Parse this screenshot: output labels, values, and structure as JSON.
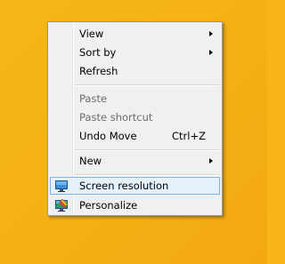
{
  "context_menu": {
    "items": [
      {
        "label": "View",
        "submenu": true
      },
      {
        "label": "Sort by",
        "submenu": true
      },
      {
        "label": "Refresh"
      },
      {
        "label": "Paste",
        "disabled": true
      },
      {
        "label": "Paste shortcut",
        "disabled": true
      },
      {
        "label": "Undo Move",
        "shortcut": "Ctrl+Z"
      },
      {
        "label": "New",
        "submenu": true
      },
      {
        "label": "Screen resolution",
        "icon": "screen-resolution-icon",
        "highlighted": true
      },
      {
        "label": "Personalize",
        "icon": "personalize-icon"
      }
    ]
  },
  "colors": {
    "desktop_background": "#f5b015",
    "menu_background": "#f0f0f0",
    "highlight_fill": "#e5f1fb",
    "highlight_border": "#7eb4ea",
    "disabled_text": "#6d6d6d"
  }
}
